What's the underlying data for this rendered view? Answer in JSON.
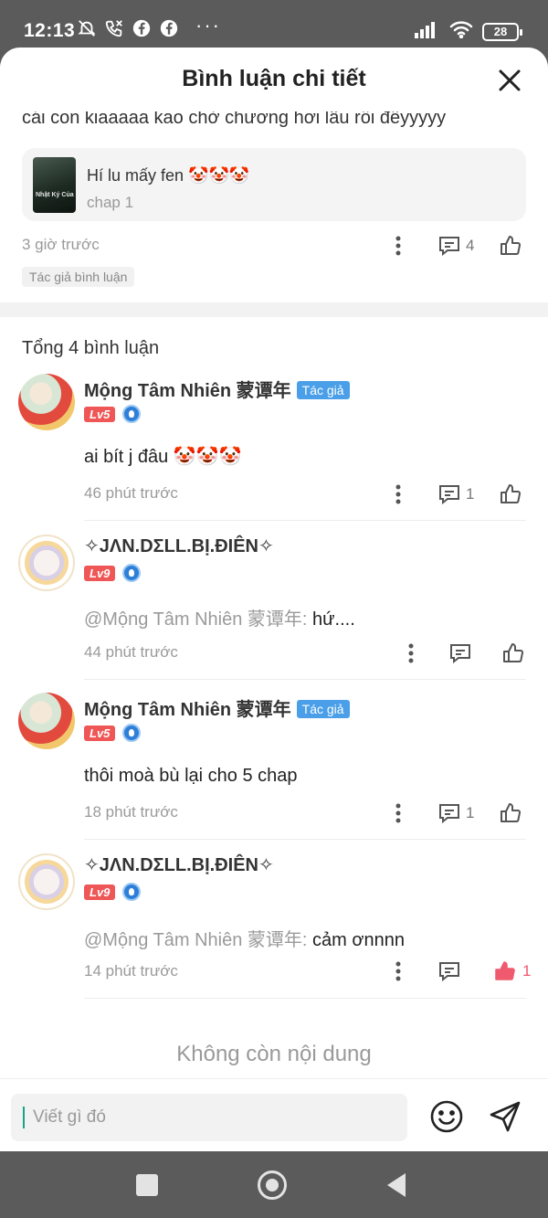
{
  "status_bar": {
    "time": "12:13",
    "battery": "28"
  },
  "header": {
    "title": "Bình luận chi tiết"
  },
  "top_comment": {
    "text": "cái con kiaaaaa kao chờ chương hơi lâu rồi đếyyyyy",
    "card_title": "Hí lu mấy fen 🤡🤡🤡",
    "card_subtitle": "chap 1",
    "cover_text": "Nhật Ký Của",
    "time": "3 giờ trước",
    "comment_count": "4",
    "author_tag": "Tác giả bình luận"
  },
  "total_label": "Tổng 4 bình luận",
  "replies": [
    {
      "name": "Mộng Tâm Nhiên 蒙谭年",
      "badge": "Tác giả",
      "level": "Lv5",
      "mention": "",
      "text": "ai bít j đâu 🤡🤡🤡",
      "time": "46 phút trước",
      "comment_count": "1",
      "like_count": "",
      "liked": false
    },
    {
      "name": "✧JΛN.DΣLL.BỊ.ĐIÊN✧",
      "badge": "",
      "level": "Lv9",
      "mention": "@Mộng Tâm Nhiên 蒙谭年:",
      "text": "hứ....",
      "time": "44 phút trước",
      "comment_count": "",
      "like_count": "",
      "liked": false
    },
    {
      "name": "Mộng Tâm Nhiên 蒙谭年",
      "badge": "Tác giả",
      "level": "Lv5",
      "mention": "",
      "text": "thôi moà bù lại cho 5 chap",
      "time": "18 phút trước",
      "comment_count": "1",
      "like_count": "",
      "liked": false
    },
    {
      "name": "✧JΛN.DΣLL.BỊ.ĐIÊN✧",
      "badge": "",
      "level": "Lv9",
      "mention": "@Mộng Tâm Nhiên 蒙谭年:",
      "text": "cảm ơnnnn",
      "time": "14 phút trước",
      "comment_count": "",
      "like_count": "1",
      "liked": true
    }
  ],
  "end_text": "Không còn nội dung",
  "input": {
    "placeholder": "Viết gì đó"
  },
  "colors": {
    "accent_like": "#ef5a6f",
    "badge_blue": "#4a9fe8",
    "level_red": "#ef5656"
  }
}
